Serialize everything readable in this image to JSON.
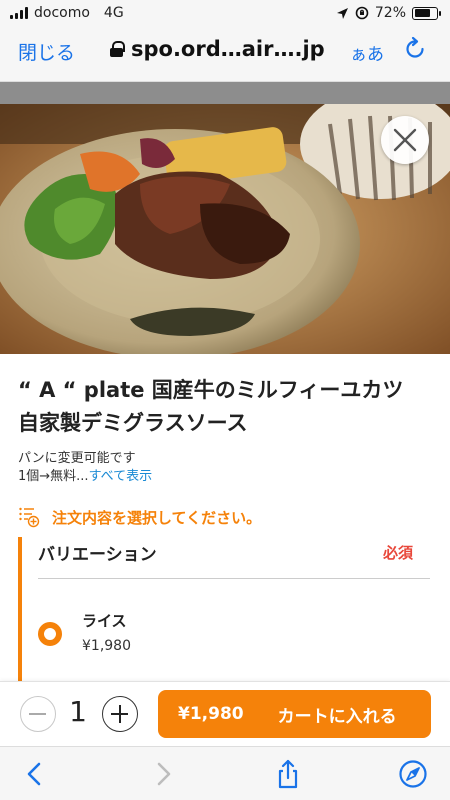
{
  "status_bar": {
    "carrier": "docomo",
    "network": "4G",
    "battery": "72%",
    "battery_level": 0.72,
    "icons": [
      "signal-icon",
      "location-icon",
      "rotation-lock-icon",
      "battery-icon"
    ]
  },
  "browser": {
    "close_label": "閉じる",
    "url": "spo.ord…air….jp",
    "text_size_label": "ぁあ",
    "icons": [
      "lock-icon",
      "reload-icon",
      "back-icon",
      "forward-icon",
      "share-icon",
      "compass-icon"
    ]
  },
  "product": {
    "title": "“ A “ plate 国産牛のミルフィーユカツ　自家製デミグラスソース",
    "description_line1": "パンに変更可能です",
    "description_line2": "1個→無料...",
    "show_all": "すべて表示",
    "instruction": "注文内容を選択してください。"
  },
  "variation": {
    "title": "バリエーション",
    "required_label": "必須",
    "options": [
      {
        "name": "ライス",
        "price": "¥1,980",
        "selected": true
      }
    ]
  },
  "cart": {
    "quantity": "1",
    "price": "¥1,980",
    "add_label": "カートに入れる"
  },
  "colors": {
    "accent": "#f5820a",
    "link": "#1a73e8",
    "required": "#e8473a"
  }
}
